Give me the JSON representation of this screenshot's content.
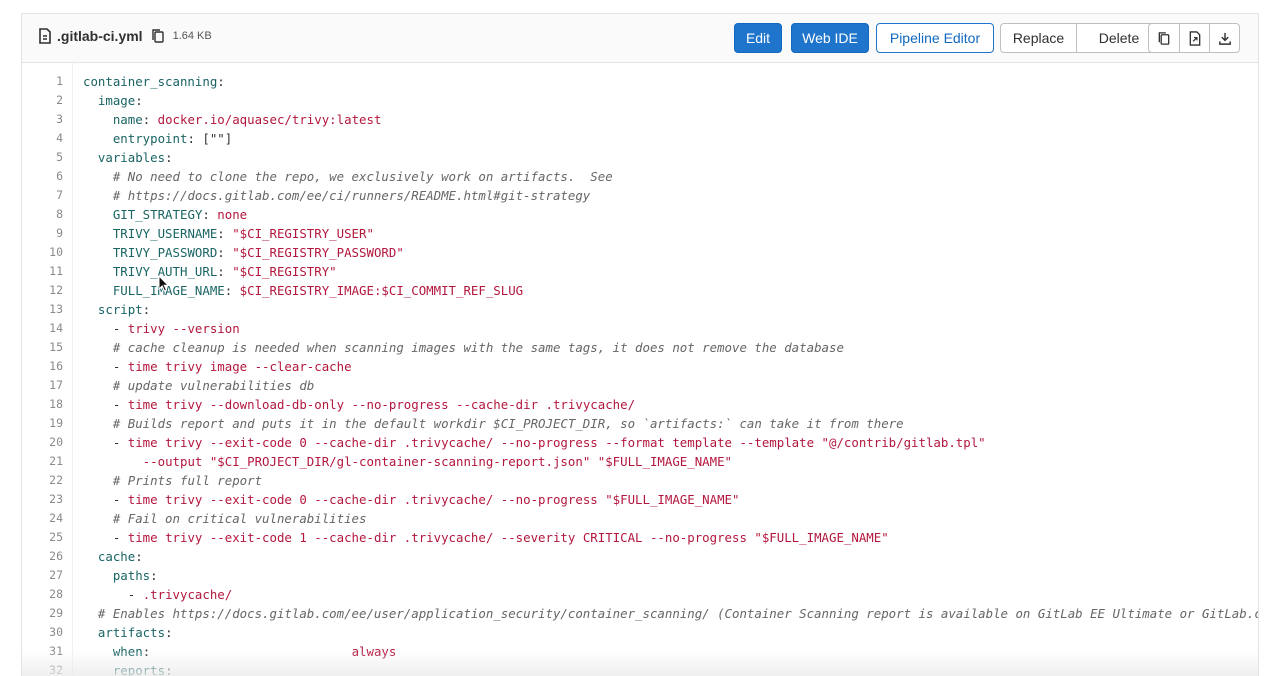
{
  "file": {
    "name": ".gitlab-ci.yml",
    "size": "1.64 KB",
    "icon": "file-icon",
    "copy_icon": "copy-path-icon"
  },
  "toolbar": {
    "edit": "Edit",
    "web_ide": "Web IDE",
    "pipeline_editor": "Pipeline Editor",
    "replace": "Replace",
    "delete": "Delete",
    "icons": [
      "copy-contents-icon",
      "open-raw-icon",
      "download-icon"
    ]
  },
  "colors": {
    "primary": "#1f75cb",
    "key": "#1a6464",
    "string": "#b3173d",
    "comment": "#666666"
  },
  "code": {
    "lines": [
      [
        [
          "k",
          "container_scanning"
        ],
        [
          "p",
          ":"
        ]
      ],
      [
        [
          "p",
          "  "
        ],
        [
          "k",
          "image"
        ],
        [
          "p",
          ":"
        ]
      ],
      [
        [
          "p",
          "    "
        ],
        [
          "k",
          "name"
        ],
        [
          "p",
          ": "
        ],
        [
          "s",
          "docker.io/aquasec/trivy:latest"
        ]
      ],
      [
        [
          "p",
          "    "
        ],
        [
          "k",
          "entrypoint"
        ],
        [
          "p",
          ": [\"\"]"
        ]
      ],
      [
        [
          "p",
          "  "
        ],
        [
          "k",
          "variables"
        ],
        [
          "p",
          ":"
        ]
      ],
      [
        [
          "p",
          "    "
        ],
        [
          "c",
          "# No need to clone the repo, we exclusively work on artifacts.  See"
        ]
      ],
      [
        [
          "p",
          "    "
        ],
        [
          "c",
          "# https://docs.gitlab.com/ee/ci/runners/README.html#git-strategy"
        ]
      ],
      [
        [
          "p",
          "    "
        ],
        [
          "k",
          "GIT_STRATEGY"
        ],
        [
          "p",
          ": "
        ],
        [
          "s",
          "none"
        ]
      ],
      [
        [
          "p",
          "    "
        ],
        [
          "k",
          "TRIVY_USERNAME"
        ],
        [
          "p",
          ": "
        ],
        [
          "s",
          "\"$CI_REGISTRY_USER\""
        ]
      ],
      [
        [
          "p",
          "    "
        ],
        [
          "k",
          "TRIVY_PASSWORD"
        ],
        [
          "p",
          ": "
        ],
        [
          "s",
          "\"$CI_REGISTRY_PASSWORD\""
        ]
      ],
      [
        [
          "p",
          "    "
        ],
        [
          "k",
          "TRIVY_AUTH_URL"
        ],
        [
          "p",
          ": "
        ],
        [
          "s",
          "\"$CI_REGISTRY\""
        ]
      ],
      [
        [
          "p",
          "    "
        ],
        [
          "k",
          "FULL_IMAGE_NAME"
        ],
        [
          "p",
          ": "
        ],
        [
          "s",
          "$CI_REGISTRY_IMAGE:$CI_COMMIT_REF_SLUG"
        ]
      ],
      [
        [
          "p",
          "  "
        ],
        [
          "k",
          "script"
        ],
        [
          "p",
          ":"
        ]
      ],
      [
        [
          "p",
          "    - "
        ],
        [
          "s",
          "trivy --version"
        ]
      ],
      [
        [
          "p",
          "    "
        ],
        [
          "c",
          "# cache cleanup is needed when scanning images with the same tags, it does not remove the database"
        ]
      ],
      [
        [
          "p",
          "    - "
        ],
        [
          "s",
          "time trivy image --clear-cache"
        ]
      ],
      [
        [
          "p",
          "    "
        ],
        [
          "c",
          "# update vulnerabilities db"
        ]
      ],
      [
        [
          "p",
          "    - "
        ],
        [
          "s",
          "time trivy --download-db-only --no-progress --cache-dir .trivycache/"
        ]
      ],
      [
        [
          "p",
          "    "
        ],
        [
          "c",
          "# Builds report and puts it in the default workdir $CI_PROJECT_DIR, so `artifacts:` can take it from there"
        ]
      ],
      [
        [
          "p",
          "    - "
        ],
        [
          "s",
          "time trivy --exit-code 0 --cache-dir .trivycache/ --no-progress --format template --template \"@/contrib/gitlab.tpl\""
        ]
      ],
      [
        [
          "p",
          "        "
        ],
        [
          "s",
          "--output \"$CI_PROJECT_DIR/gl-container-scanning-report.json\" \"$FULL_IMAGE_NAME\""
        ]
      ],
      [
        [
          "p",
          "    "
        ],
        [
          "c",
          "# Prints full report"
        ]
      ],
      [
        [
          "p",
          "    - "
        ],
        [
          "s",
          "time trivy --exit-code 0 --cache-dir .trivycache/ --no-progress \"$FULL_IMAGE_NAME\""
        ]
      ],
      [
        [
          "p",
          "    "
        ],
        [
          "c",
          "# Fail on critical vulnerabilities"
        ]
      ],
      [
        [
          "p",
          "    - "
        ],
        [
          "s",
          "time trivy --exit-code 1 --cache-dir .trivycache/ --severity CRITICAL --no-progress \"$FULL_IMAGE_NAME\""
        ]
      ],
      [
        [
          "p",
          "  "
        ],
        [
          "k",
          "cache"
        ],
        [
          "p",
          ":"
        ]
      ],
      [
        [
          "p",
          "    "
        ],
        [
          "k",
          "paths"
        ],
        [
          "p",
          ":"
        ]
      ],
      [
        [
          "p",
          "      - "
        ],
        [
          "s",
          ".trivycache/"
        ]
      ],
      [
        [
          "p",
          "  "
        ],
        [
          "c",
          "# Enables https://docs.gitlab.com/ee/user/application_security/container_scanning/ (Container Scanning report is available on GitLab EE Ultimate or GitLab.com Gold)"
        ]
      ],
      [
        [
          "p",
          "  "
        ],
        [
          "k",
          "artifacts"
        ],
        [
          "p",
          ":"
        ]
      ],
      [
        [
          "p",
          "    "
        ],
        [
          "k",
          "when"
        ],
        [
          "p",
          ":                           "
        ],
        [
          "s",
          "always"
        ]
      ],
      [
        [
          "p",
          "    "
        ],
        [
          "k",
          "reports"
        ],
        [
          "p",
          ":"
        ]
      ]
    ]
  }
}
